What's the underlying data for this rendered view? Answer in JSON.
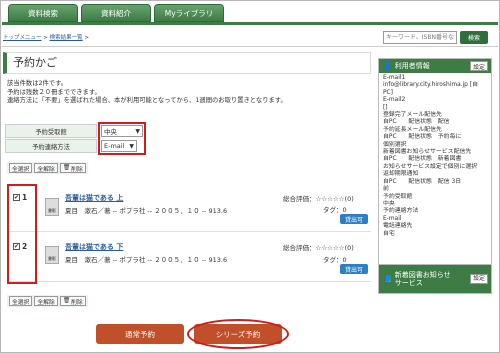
{
  "tabs": [
    "資料検索",
    "資料紹介",
    "Myライブラリ"
  ],
  "breadcrumb": {
    "home": "トップメニュー",
    "sep1": " > ",
    "link": "検索結果一覧",
    "sep2": " >"
  },
  "search": {
    "placeholder": "キーワード、ISBN番号な",
    "button": "検索"
  },
  "page_title": "予約かご",
  "info": [
    "該当件数は2件です。",
    "予約は残数２０冊までできます。",
    "連絡方法に「不要」を選ばれた場合、本が利用可能となってから、1週間のお取り置きとなります。"
  ],
  "options": {
    "pickup_label": "予約受取館",
    "pickup_value": "中央",
    "contact_label": "予約連絡方法",
    "contact_value": "E-mail"
  },
  "buttons": {
    "select_all": "全選択",
    "deselect_all": "全解除",
    "delete": "削除"
  },
  "items": [
    {
      "checked": "✔",
      "num": "1",
      "title": "吾輩は猫である 上",
      "meta": "夏目　漱石／著 -- ポプラ社 -- ２００５．１０ -- 913.6",
      "rating": "総合評価：☆☆☆☆☆(0)",
      "tag": "タグ：0",
      "lend": "貸出可",
      "book_label": "書影"
    },
    {
      "checked": "✔",
      "num": "2",
      "title": "吾輩は猫である 下",
      "meta": "夏目　漱石／著 -- ポプラ社 -- ２００５．１０ -- 913.6",
      "rating": "総合評価：☆☆☆☆☆(0)",
      "tag": "タグ：0",
      "lend": "貸出可",
      "book_label": "書影"
    }
  ],
  "actions": {
    "normal": "通常予約",
    "series": "シリーズ予約"
  },
  "sidebar": {
    "user_title": "利用者情報",
    "settings": "設定",
    "user_lines": [
      "E-mail1",
      "info@library.city.hiroshima.jp [自",
      "PC]",
      "E-mail2",
      "[]",
      "登録完了メール配信先",
      "自PC　　配信状態　配信",
      "予約延長メール配信先",
      "自PC　　配信状態　予約毎に",
      "個別選択",
      "新着図書お知らせサービス配信先",
      "自PC　　配信状態　新着図書",
      "お知らせサービス設定で個別に選択",
      "返却期限通知",
      "自PC　　配信状態　配信 3日",
      "前",
      "予約受取館",
      "中央",
      "予約連絡方法",
      "E-mail",
      "電話連絡先",
      "自宅"
    ],
    "newbook_title": "新着図書お知らせサービス",
    "newbook_settings": "設定"
  },
  "colors": {
    "accent": "#3e7c46",
    "highlight": "#d21c1c",
    "normal_btn": "#c0502a",
    "series_btn": "#c0502a"
  }
}
